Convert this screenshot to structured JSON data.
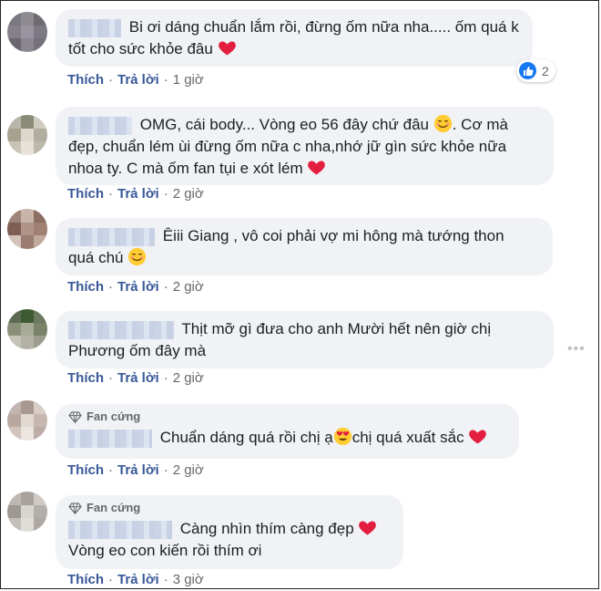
{
  "actions": {
    "like": "Thích",
    "reply": "Trả lời",
    "separator": "·"
  },
  "badge_label": "Fan cứng",
  "comments": [
    {
      "line1": "Bi ơi dáng chuẩn lắm rồi, đừng ốm nữa nha..... ốm quá k",
      "line2": "tốt cho sức khỏe đâu",
      "time": "1 giờ",
      "reactions": "2"
    },
    {
      "line1": "OMG, cái body... Vòng eo 56 đây chứ đâu",
      "line1b": ". Cơ mà",
      "line2": "đẹp, chuẩn lém ùi đừng ốm nữa c nha,nhớ jữ gìn sức khỏe nữa",
      "line3": "nhoa ty. C mà ốm fan tụi e xót lém",
      "time": "2 giờ"
    },
    {
      "line1": "Êiii Giang , vô coi phải vợ mi hông mà tướng thon",
      "line2": "quá chú",
      "time": "2 giờ"
    },
    {
      "line1": "Thịt mỡ gì đưa cho anh Mười hết nên giờ chị",
      "line2": "Phương ốm đây mà",
      "time": "2 giờ"
    },
    {
      "line1a": "Chuẩn dáng quá rồi chị ạ",
      "line1b": "chị quá xuất sắc",
      "time": "2 giờ"
    },
    {
      "line1": "Càng nhìn thím càng đẹp",
      "line2": "Vòng eo con kiến rồi thím ơi",
      "time": "3 giờ"
    }
  ],
  "icons": {
    "like": "like-icon",
    "heart": "heart-emoji",
    "smile": "smiling-face-emoji",
    "heart_eyes": "heart-eyes-emoji",
    "diamond": "diamond-icon",
    "more": "more-options-icon"
  },
  "colors": {
    "bubble": "#f0f2f5",
    "link": "#385898",
    "like": "#1877f2",
    "heart": "#e41e3f",
    "text": "#1c1e21",
    "meta": "#65676b"
  }
}
